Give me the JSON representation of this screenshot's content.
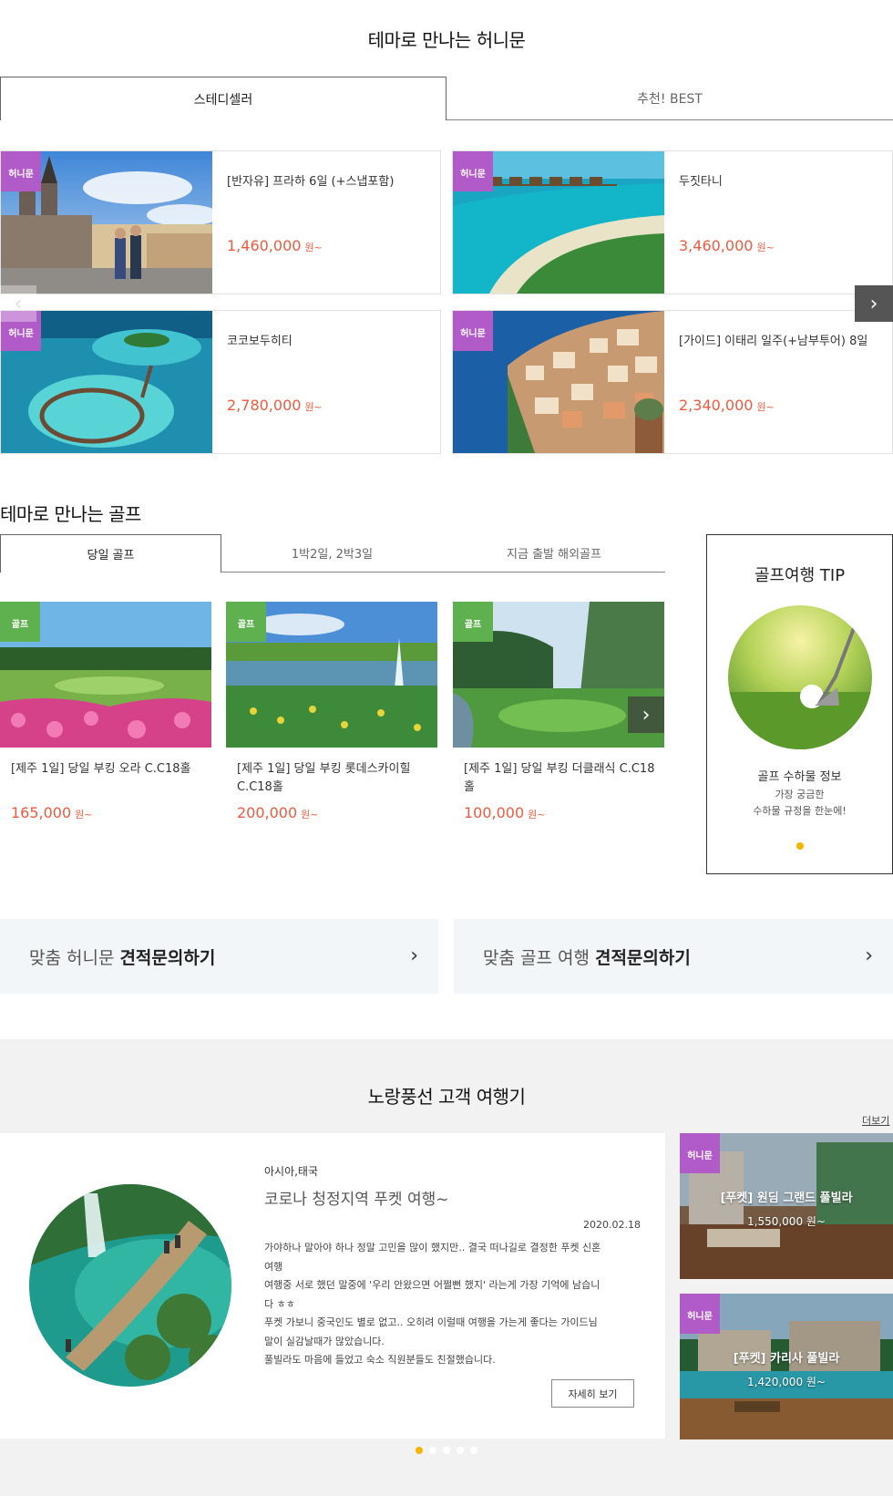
{
  "honeymoon": {
    "title": "테마로 만나는 허니문",
    "tabs": [
      "스테디셀러",
      "추천! BEST"
    ],
    "badge": "허니문",
    "currency": "원~",
    "items": [
      {
        "name": "[반자유] 프라하 6일 (+스냅포함)",
        "price": "1,460,000"
      },
      {
        "name": "두짓타니",
        "price": "3,460,000"
      },
      {
        "name": "코코보두히티",
        "price": "2,780,000"
      },
      {
        "name": "[가이드] 이태리 일주(+남부투어) 8일",
        "price": "2,340,000"
      }
    ],
    "prev_icon": "chevron-left-icon",
    "next_icon": "chevron-right-icon"
  },
  "golf": {
    "title": "테마로 만나는 골프",
    "tabs": [
      "당일 골프",
      "1박2일, 2박3일",
      "지금 출발 해외골프"
    ],
    "badge": "골프",
    "currency": "원~",
    "items": [
      {
        "name": "[제주 1일] 당일 부킹 오라 C.C18홀",
        "price": "165,000"
      },
      {
        "name": "[제주 1일] 당일 부킹 롯데스카이힐 C.C18홀",
        "price": "200,000"
      },
      {
        "name": "[제주 1일] 당일 부킹 더클래식 C.C18홀",
        "price": "100,000"
      }
    ],
    "tip": {
      "title": "골프여행 TIP",
      "subtitle": "골프 수하물 정보",
      "line1": "가장 궁금한",
      "line2": "수하물 규정을 한눈에!"
    }
  },
  "inquiry": {
    "honeymoon_pre": "맞춤 허니문",
    "golf_pre": "맞춤 골프 여행",
    "action": "견적문의하기"
  },
  "review": {
    "title": "노랑풍선 고객 여행기",
    "more": "더보기",
    "region": "아시아,태국",
    "headline": "코로나 청정지역 푸켓 여행~",
    "date": "2020.02.18",
    "body": [
      "가야하나 말아야 하나 정말 고민을 많이 했지만.. 결국 떠나길로 결정한 푸켓 신혼",
      "여행",
      "여행중 서로 했던 말중에 '우리 안왔으면 어쩔뻔 했지' 라는게 가장 기억에 남습니",
      "다 ㅎㅎ",
      "푸켓 가보니 중국인도 별로 없고.. 오히려 이럴때 여행을 가는게 좋다는 가이드님",
      "말이 실감날때가 많았습니다.",
      "풀빌라도 마음에 들었고 숙소 직원분들도 친절했습니다."
    ],
    "detail_button": "자세히 보기",
    "side": [
      {
        "badge": "허니문",
        "name": "[푸켓] 원딤 그랜드 풀빌라",
        "price": "1,550,000 원~"
      },
      {
        "badge": "허니문",
        "name": "[푸켓] 카리사 풀빌라",
        "price": "1,420,000 원~"
      }
    ],
    "pagination": {
      "count": 5,
      "active": 1
    }
  },
  "colors": {
    "price": "#ee5a3e",
    "honey_badge": "#b15bc8",
    "golf_badge": "#5fb04f",
    "dot_active": "#f5b400"
  }
}
